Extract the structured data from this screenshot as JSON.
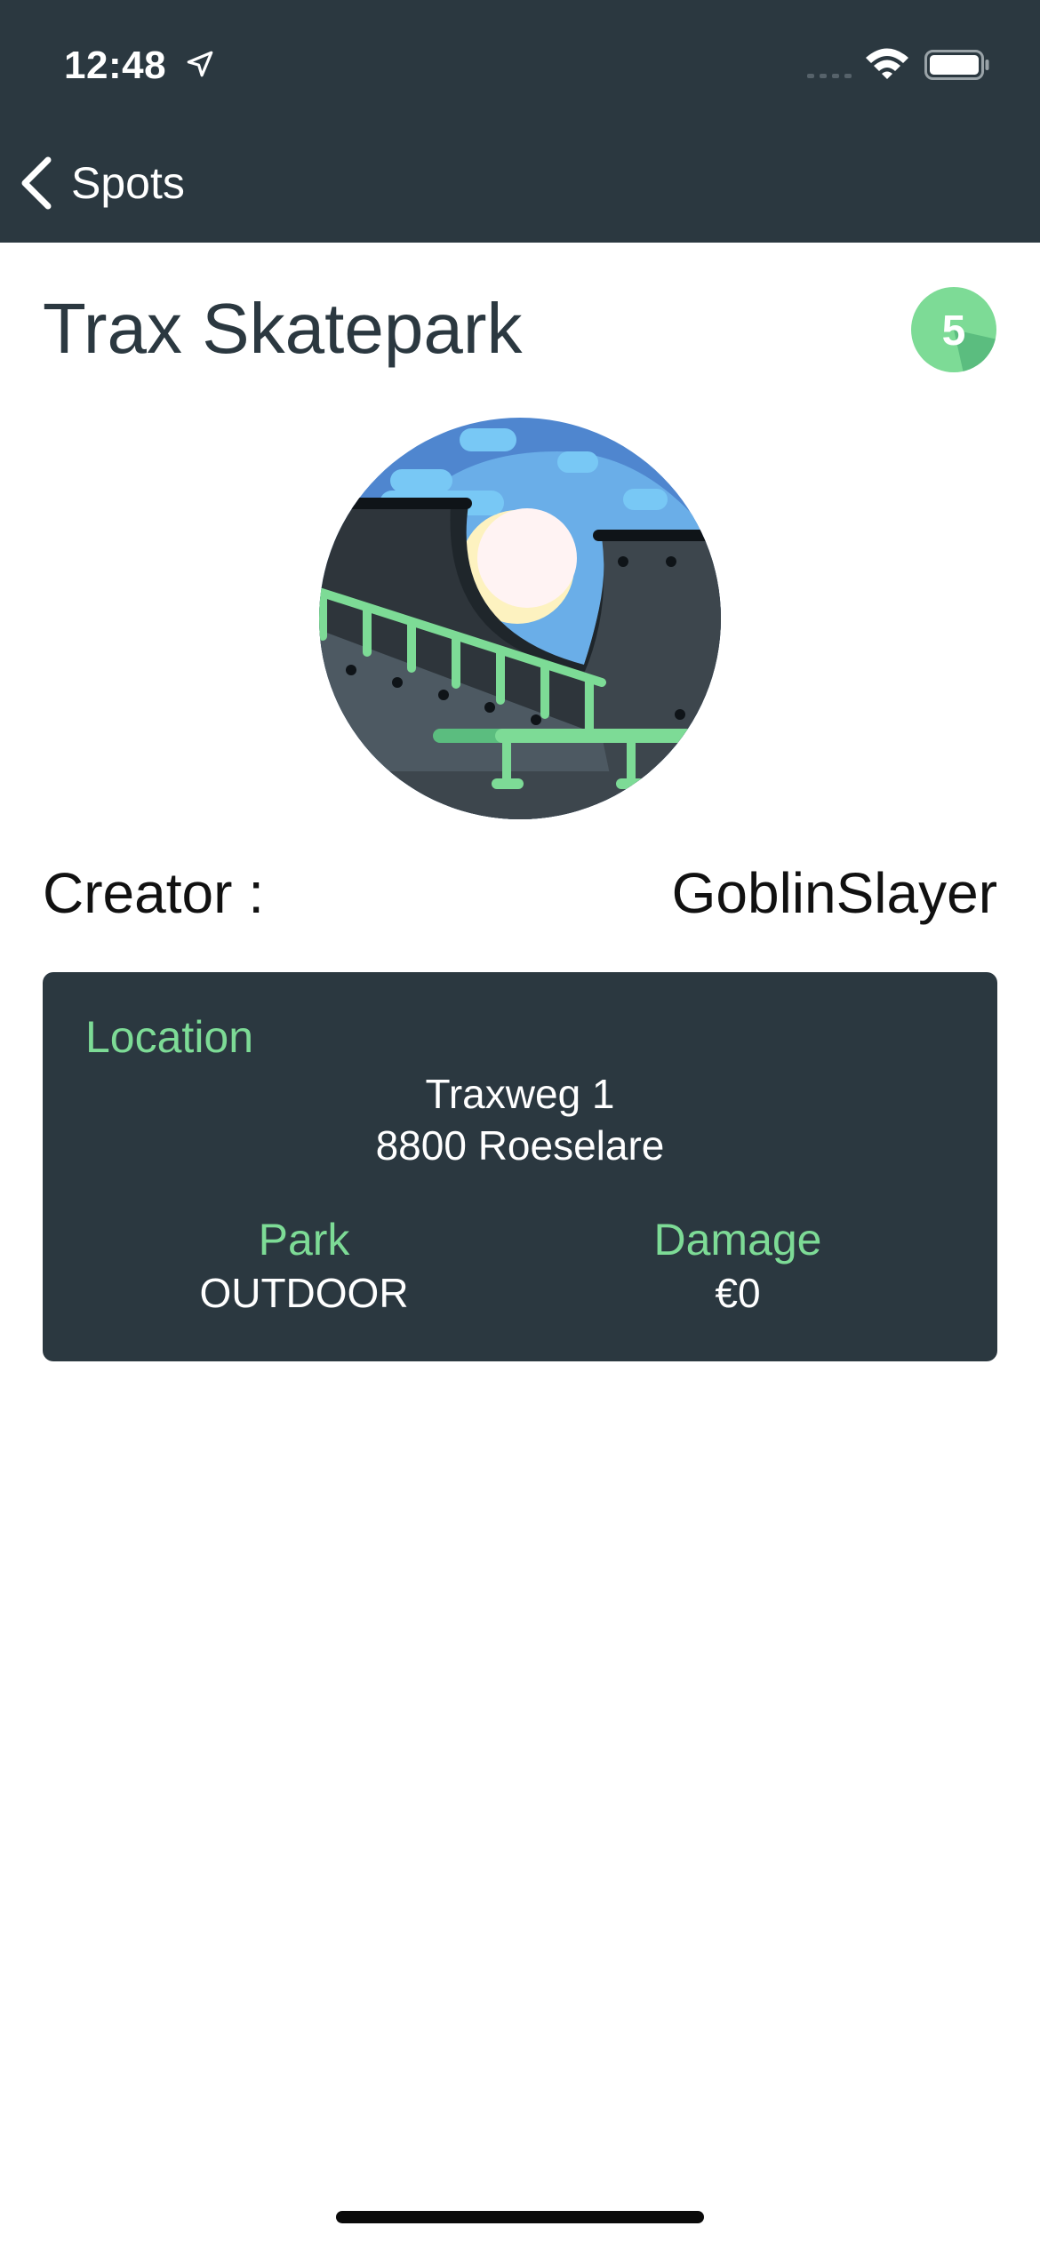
{
  "status_bar": {
    "time": "12:48",
    "icons": [
      "location-arrow-icon",
      "cellular-signal-icon",
      "wifi-icon",
      "battery-icon"
    ]
  },
  "nav": {
    "back_label": "Spots",
    "back_icon": "chevron-left-icon"
  },
  "spot": {
    "title": "Trax Skatepark",
    "rating": "5",
    "image_icon": "skatepark-illustration",
    "creator_label": "Creator :",
    "creator_name": "GoblinSlayer"
  },
  "details": {
    "location_label": "Location",
    "address_line1": "Traxweg 1",
    "address_line2": "8800 Roeselare",
    "park_label": "Park",
    "park_value": "OUTDOOR",
    "damage_label": "Damage",
    "damage_value": "€0"
  },
  "colors": {
    "header_bg": "#2b3840",
    "accent_green": "#7ddb96",
    "badge_green": "#5bc98a",
    "card_bg": "#2b3840"
  }
}
